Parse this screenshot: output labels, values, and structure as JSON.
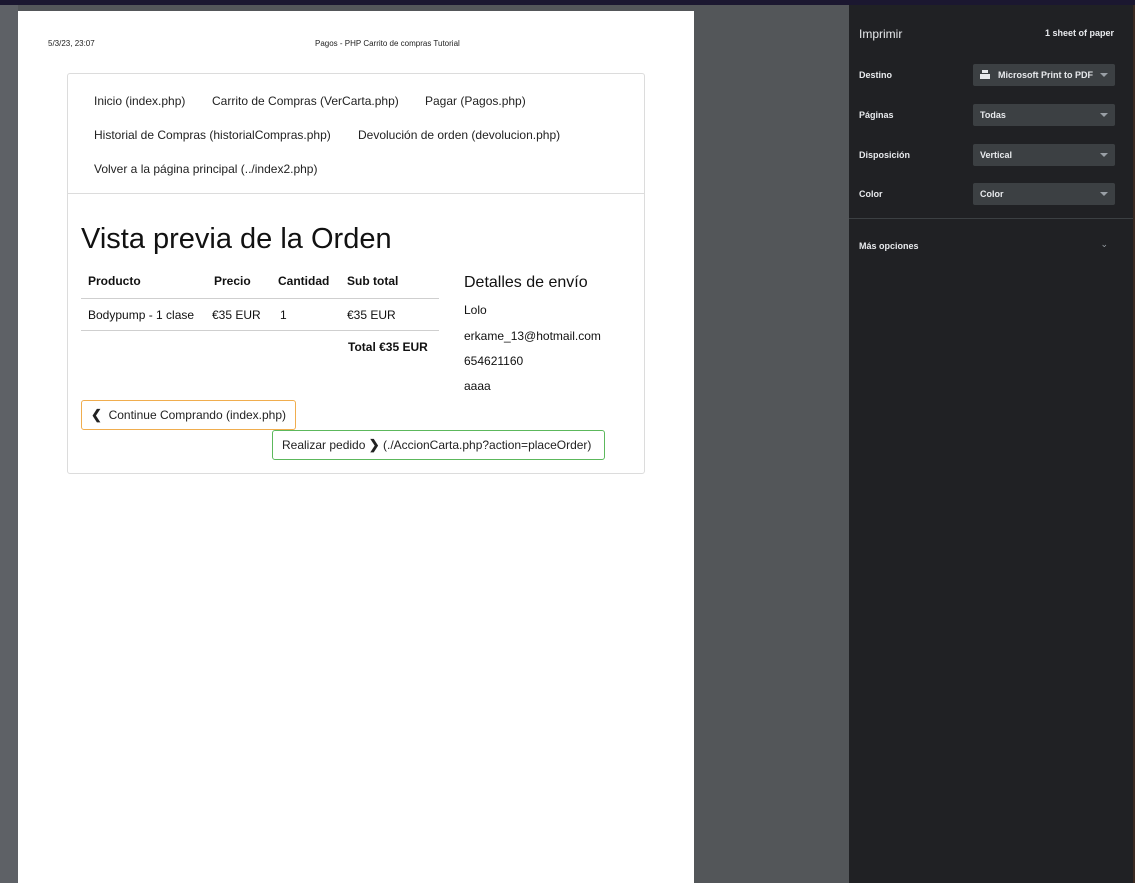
{
  "page": {
    "date": "5/3/23, 23:07",
    "header_title": "Pagos - PHP Carrito de compras Tutorial"
  },
  "nav": {
    "items": [
      "Inicio (index.php)",
      "Carrito de Compras (VerCarta.php)",
      "Pagar (Pagos.php)",
      "Historial de Compras (historialCompras.php)",
      "Devolución de orden (devolucion.php)",
      "Volver a la página principal (../index2.php)"
    ]
  },
  "order": {
    "title": "Vista previa de la Orden",
    "columns": [
      "Producto",
      "Precio",
      "Cantidad",
      "Sub total"
    ],
    "rows": [
      {
        "producto": "Bodypump - 1 clase",
        "precio": "€35 EUR",
        "cantidad": "1",
        "subtotal": "€35 EUR"
      }
    ],
    "total": "Total €35 EUR"
  },
  "shipping": {
    "title": "Detalles de envío",
    "name": "Lolo",
    "email": "erkame_13@hotmail.com",
    "phone": "654621160",
    "address": "aaaa"
  },
  "buttons": {
    "continue": "Continue Comprando (index.php)",
    "place_order": "Realizar pedido",
    "place_order_url": "(./AccionCarta.php?action=placeOrder)"
  },
  "print_panel": {
    "title": "Imprimir",
    "sheets": "1 sheet of paper",
    "destination_label": "Destino",
    "destination_value": "Microsoft Print to PDF",
    "pages_label": "Páginas",
    "pages_value": "Todas",
    "layout_label": "Disposición",
    "layout_value": "Vertical",
    "color_label": "Color",
    "color_value": "Color",
    "more_options": "Más opciones"
  }
}
